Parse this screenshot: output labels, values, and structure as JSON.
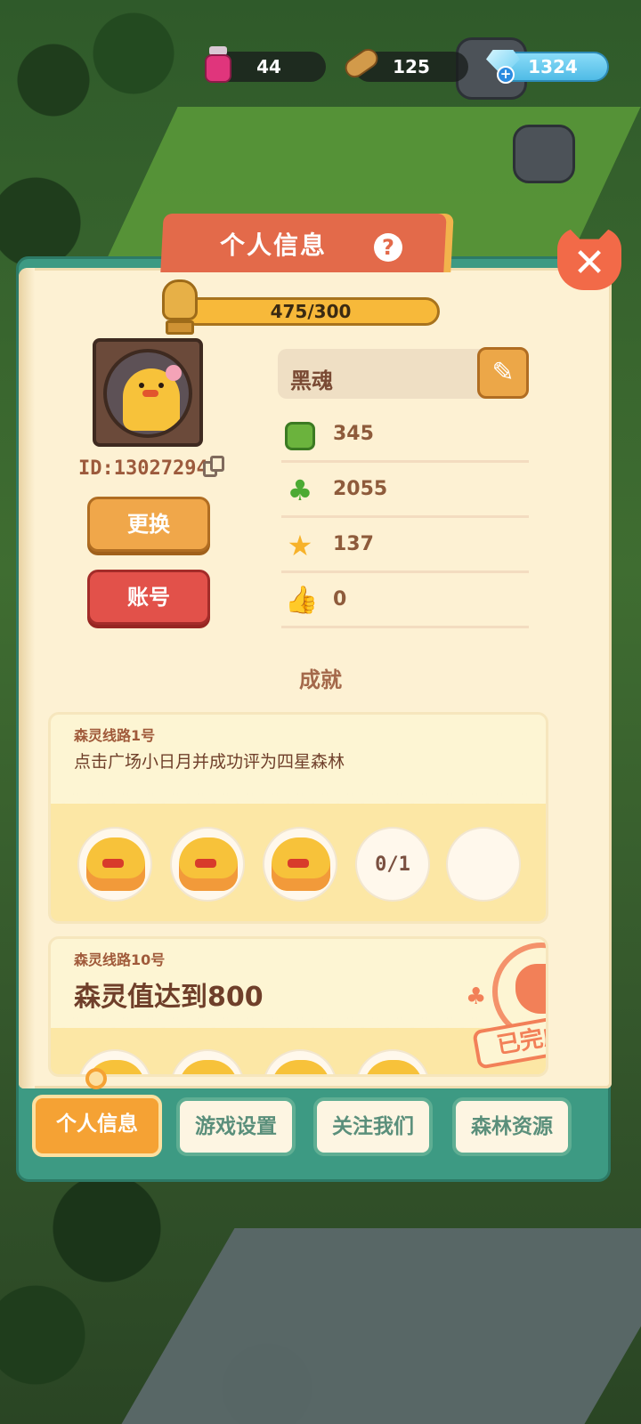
{
  "resources": {
    "ink": {
      "value": "44",
      "icon": "ink-bottle-icon"
    },
    "wood": {
      "value": "125",
      "icon": "wood-log-icon"
    },
    "gem": {
      "value": "1324",
      "icon": "diamond-gem-icon"
    }
  },
  "dialog": {
    "title": "个人信息",
    "help_label": "?",
    "close_label": "✕"
  },
  "profile": {
    "exp_progress": "475/300",
    "user_id": "ID:13027294",
    "change_button": "更换",
    "account_button": "账号",
    "nickname": "黑魂",
    "edit_icon": "✎",
    "stats": [
      {
        "icon": "grass-block-icon",
        "value": "345"
      },
      {
        "icon": "clover-icon",
        "value": "2055"
      },
      {
        "icon": "star-icon",
        "value": "137"
      },
      {
        "icon": "thumbs-up-icon",
        "value": "0"
      }
    ]
  },
  "achievements": {
    "section_title": "成就",
    "items": [
      {
        "name": "森灵线路1号",
        "description": "点击广场小日月并成功评为四星森林",
        "reward_progress": "0/1"
      },
      {
        "name": "森灵线路10号",
        "description": "森灵值达到800",
        "stamp_text": "已完成"
      }
    ]
  },
  "tabs": [
    {
      "label": "个人信息",
      "active": true
    },
    {
      "label": "游戏设置",
      "active": false
    },
    {
      "label": "关注我们",
      "active": false
    },
    {
      "label": "森林资源",
      "active": false
    }
  ],
  "colors": {
    "panel_green": "#3d9a83",
    "page_cream": "#fdf1d3",
    "title_red": "#e36a4a",
    "accent_orange": "#f5a234",
    "button_red": "#e2514a"
  }
}
